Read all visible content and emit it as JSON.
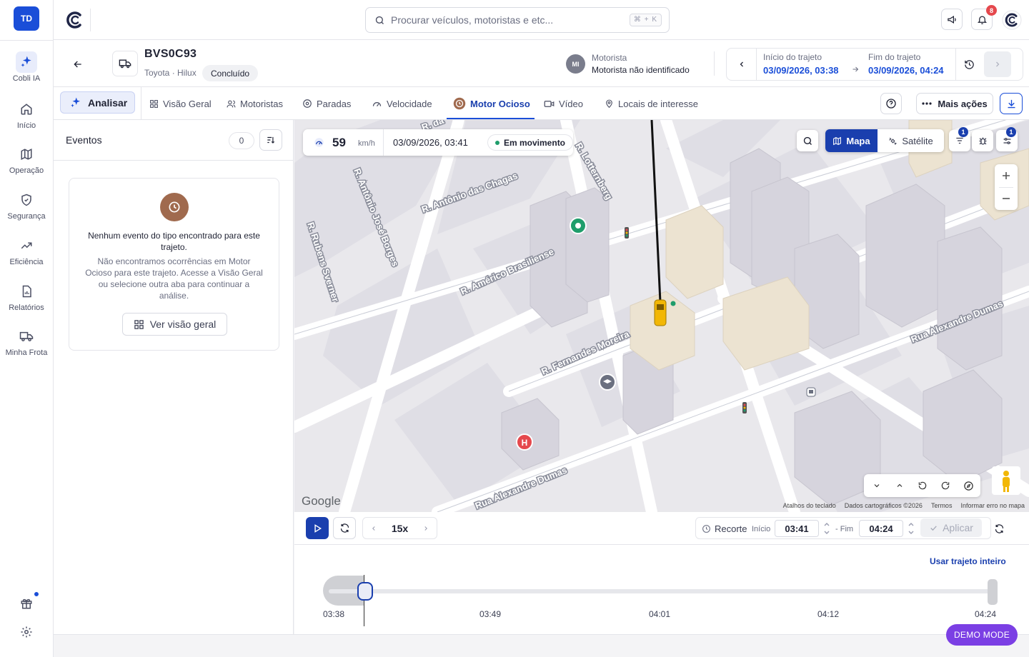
{
  "sidebar": {
    "user_initials": "TD",
    "items": [
      {
        "label": "Cobli IA",
        "icon": "sparkle-icon"
      },
      {
        "label": "Início",
        "icon": "home-icon"
      },
      {
        "label": "Operação",
        "icon": "map-icon"
      },
      {
        "label": "Segurança",
        "icon": "shield-icon"
      },
      {
        "label": "Eficiência",
        "icon": "trend-icon"
      },
      {
        "label": "Relatórios",
        "icon": "report-icon"
      },
      {
        "label": "Minha Frota",
        "icon": "truck-icon"
      }
    ]
  },
  "topbar": {
    "search_placeholder": "Procurar veículos, motoristas e etc...",
    "shortcut": "⌘ + K",
    "notification_count": "8"
  },
  "vehicle": {
    "plate": "BVS0C93",
    "model": "Toyota · Hilux",
    "status": "Concluído",
    "driver_initials": "MI",
    "driver_label": "Motorista",
    "driver_name": "Motorista não identificado",
    "trip_start_label": "Início do trajeto",
    "trip_start": "03/09/2026, 03:38",
    "trip_end_label": "Fim do trajeto",
    "trip_end": "03/09/2026, 04:24"
  },
  "tabs": {
    "analyze_label": "Analisar",
    "items": [
      {
        "label": "Visão Geral"
      },
      {
        "label": "Motoristas"
      },
      {
        "label": "Paradas"
      },
      {
        "label": "Velocidade"
      },
      {
        "label": "Motor Ocioso",
        "active": true
      },
      {
        "label": "Vídeo"
      },
      {
        "label": "Locais de interesse"
      }
    ],
    "more_actions": "Mais ações"
  },
  "events": {
    "title": "Eventos",
    "count": "0",
    "empty_title": "Nenhum evento do tipo encontrado para este trajeto.",
    "empty_desc": "Não encontramos ocorrências em Motor Ocioso para este trajeto. Acesse a Visão Geral ou selecione outra aba para continuar a análise.",
    "view_overview": "Ver visão geral"
  },
  "map": {
    "speed_value": "59",
    "speed_unit": "km/h",
    "timestamp": "03/09/2026, 03:41",
    "motion_status": "Em movimento",
    "map_type": "Mapa",
    "satellite": "Satélite",
    "filter_badge": "1",
    "layers_badge": "1",
    "streets": [
      "R. Antônio das Chagas",
      "R. Américo Brasiliense",
      "R. Fernandes Moreira",
      "Rua Alexandre Dumas",
      "Rua Alexandre Dumas",
      "R. Antônio José Borges",
      "R. Rubens Sverner",
      "R. Lotternberg",
      "R. da"
    ],
    "google_logo": "Google",
    "attribution": [
      "Atalhos do teclado",
      "Dados cartográficos ©2026",
      "Termos",
      "Informar erro no mapa"
    ]
  },
  "playback": {
    "speed": "15x",
    "recorte_label": "Recorte",
    "start_label": "Início",
    "start_value": "03:41",
    "end_label": "Fim",
    "end_value": "04:24",
    "apply_label": "Aplicar",
    "use_full": "Usar trajeto inteiro",
    "ticks": [
      "03:38",
      "03:49",
      "04:01",
      "04:12",
      "04:24"
    ],
    "progress_fraction": 0.065
  },
  "demo_mode": "DEMO MODE",
  "colors": {
    "primary": "#1a4ed8",
    "primary_dark": "#1a3fae",
    "idle_brown": "#a06a4e",
    "demo_purple": "#7b3fe4",
    "alert_red": "#e5484d"
  }
}
